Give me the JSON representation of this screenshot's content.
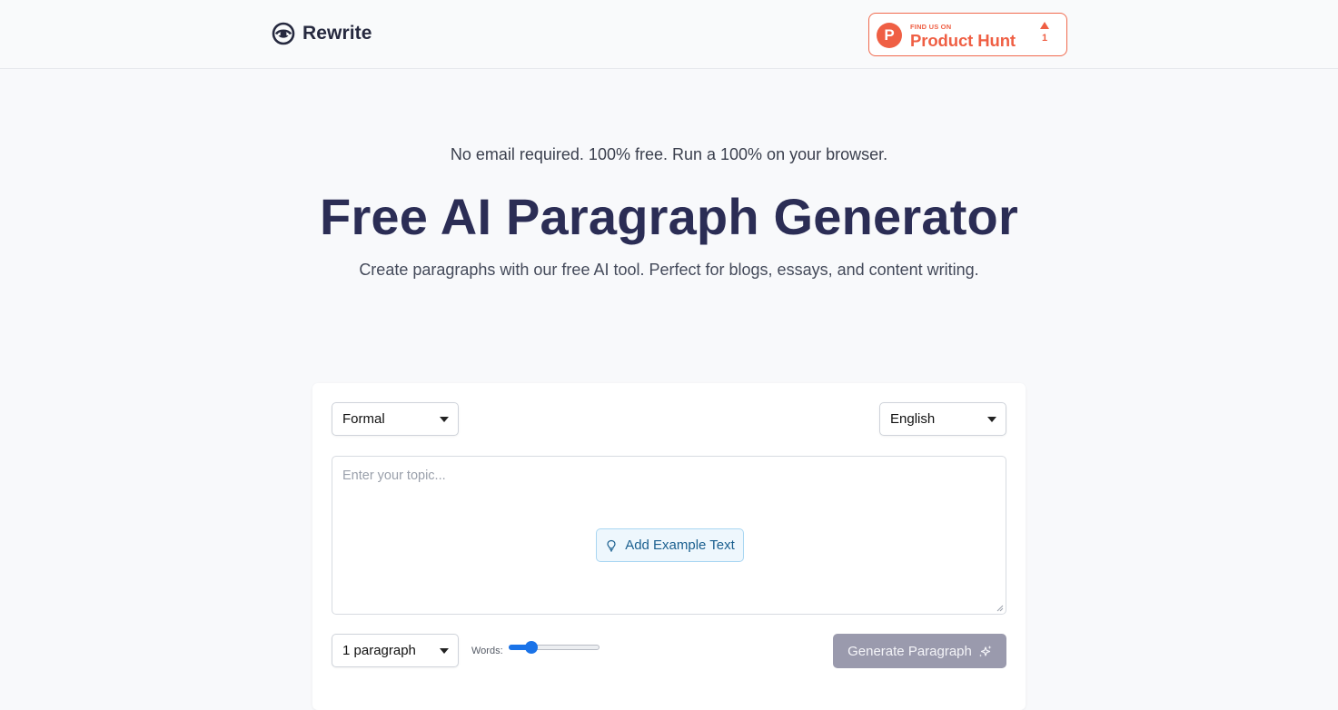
{
  "header": {
    "brand": "Rewrite",
    "product_hunt": {
      "small_text": "FIND US ON",
      "name": "Product Hunt",
      "logo_letter": "P",
      "upvotes": "1",
      "color": "#ef5f44"
    }
  },
  "hero": {
    "tagline": "No email required. 100% free. Run a 100% on your browser.",
    "title": "Free AI Paragraph Generator",
    "subtitle": "Create paragraphs with our free AI tool. Perfect for blogs, essays, and content writing."
  },
  "form": {
    "tone": {
      "selected": "Formal"
    },
    "language": {
      "selected": "English"
    },
    "topic": {
      "placeholder": "Enter your topic...",
      "value": ""
    },
    "example_button": {
      "label": "Add Example Text",
      "icon": "lightbulb-icon"
    },
    "paragraph_count": {
      "selected": "1 paragraph"
    },
    "words": {
      "label": "Words:",
      "slider_fraction": 0.25
    },
    "generate_button": {
      "label": "Generate Paragraph",
      "icon": "sparkle-icon",
      "color": "#9a9aad"
    }
  },
  "colors": {
    "accent": "#1a73e8",
    "title": "#2b2d55",
    "product_hunt": "#ef5f44"
  }
}
